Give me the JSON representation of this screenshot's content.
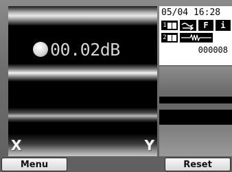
{
  "display": {
    "level": "00.02dB",
    "corner_left": "X",
    "corner_right": "Y"
  },
  "status": {
    "date": "05/04",
    "time": "16:28",
    "channel1_label": "1",
    "channel2_label": "2",
    "filter_letter": "F",
    "info_letter": "i",
    "counter": "000008"
  },
  "buttons": {
    "menu": "Menu",
    "reset": "Reset"
  },
  "icons": {
    "level_indicator": "circle-dot-icon",
    "channel1": "battery-1-icon",
    "channel2": "battery-2-icon",
    "mode": "wave-arrow-icon",
    "filter": "filter-f-icon",
    "info": "info-icon",
    "waveform": "waveform-icon"
  }
}
